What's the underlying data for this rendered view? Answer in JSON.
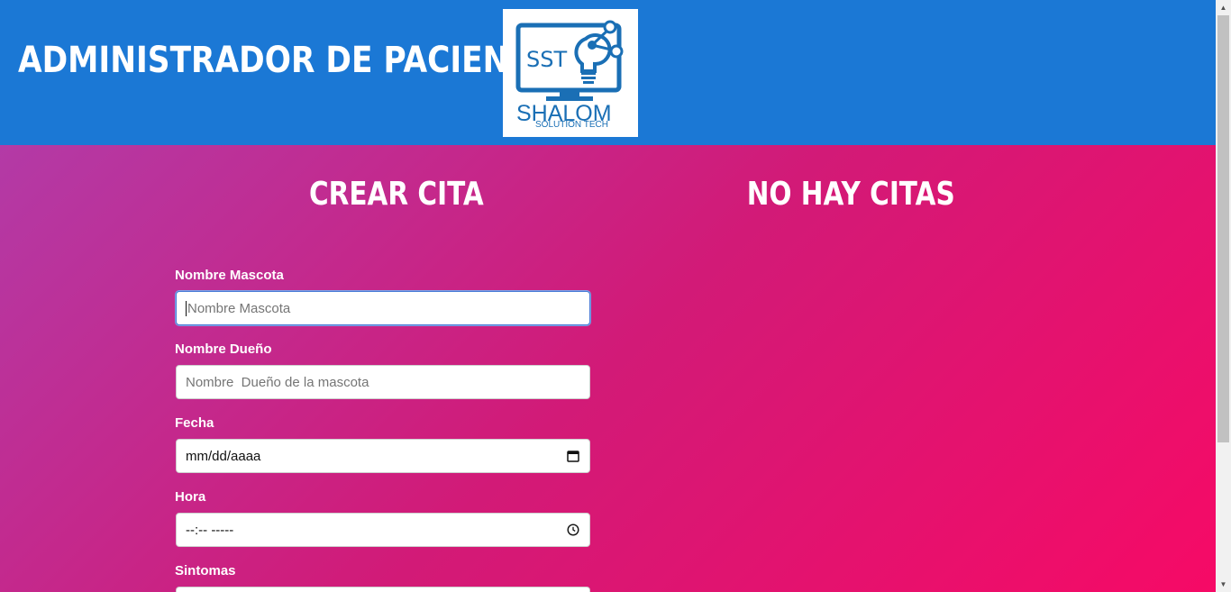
{
  "header": {
    "title": "Administrador de Pacientes",
    "logo": {
      "main_text": "SST",
      "brand": "SHALOM",
      "tagline": "SOLUTION TECH",
      "color": "#1a6fb5"
    },
    "background_color": "#1b78d5"
  },
  "form_section": {
    "title": "Crear Cita",
    "fields": [
      {
        "label": "Nombre Mascota",
        "placeholder": "Nombre Mascota",
        "value": ""
      },
      {
        "label": "Nombre Dueño",
        "placeholder": "Nombre  Dueño de la mascota",
        "value": ""
      },
      {
        "label": "Fecha",
        "value": "mm/dd/aaaa",
        "icon": "calendar-icon"
      },
      {
        "label": "Hora",
        "value": "--:-- -----",
        "icon": "clock-icon"
      },
      {
        "label": "Sintomas"
      }
    ]
  },
  "list_section": {
    "title": "No hay citas"
  },
  "colors": {
    "gradient_start": "#b33aa6",
    "gradient_end": "#f60a66",
    "focus_border": "#4a7bd6"
  }
}
